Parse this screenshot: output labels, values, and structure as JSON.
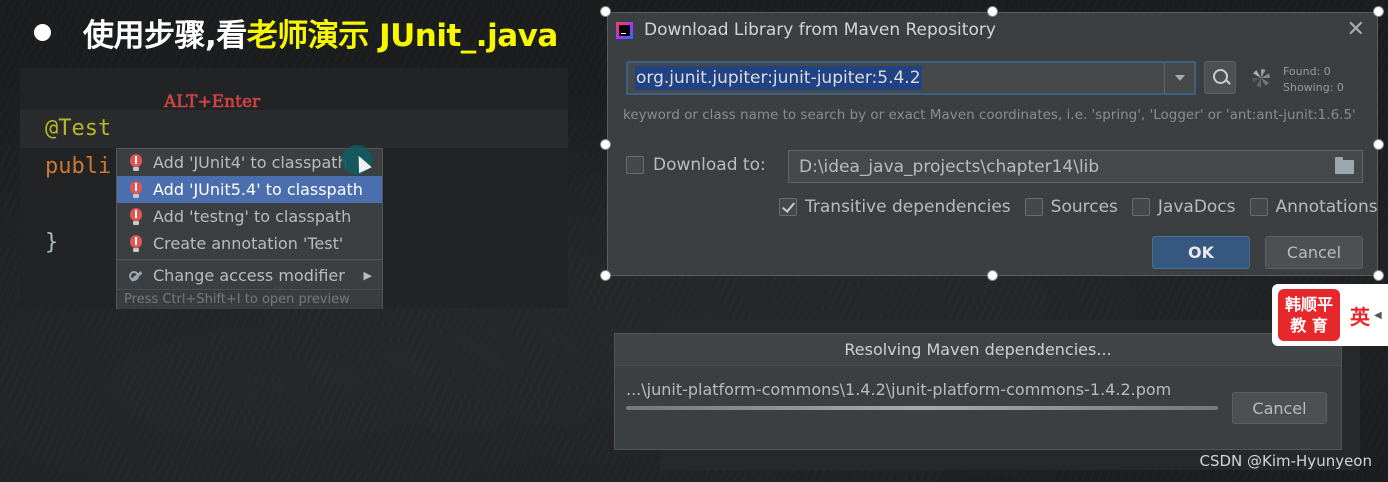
{
  "slide": {
    "title_prefix": "使用步骤,看",
    "title_highlight": "老师演示 JUnit_.java"
  },
  "editor": {
    "hint": "ALT+Enter",
    "line1": "@Test",
    "line2": "publi",
    "line3": "}"
  },
  "popup": {
    "items": [
      {
        "label": "Add 'JUnit4' to classpath"
      },
      {
        "label": "Add 'JUnit5.4' to classpath"
      },
      {
        "label": "Add 'testng' to classpath"
      },
      {
        "label": "Create annotation 'Test'"
      }
    ],
    "change_access": "Change access modifier",
    "arrow": "▶",
    "footer": "Press Ctrl+Shift+I to open preview"
  },
  "dialog": {
    "title": "Download Library from Maven Repository",
    "close": "✕",
    "search_value": "org.junit.jupiter:junit-jupiter:5.4.2",
    "found": "Found: 0",
    "showing": "Showing: 0",
    "hint": "keyword or class name to search by or exact Maven coordinates, i.e. 'spring', 'Logger' or 'ant:ant-junit:1.6.5'",
    "download_to_label": "Download to:",
    "download_path": "D:\\idea_java_projects\\chapter14\\lib",
    "options": [
      {
        "label": "Transitive dependencies",
        "checked": true
      },
      {
        "label": "Sources",
        "checked": false
      },
      {
        "label": "JavaDocs",
        "checked": false
      },
      {
        "label": "Annotations",
        "checked": false
      }
    ],
    "ok": "OK",
    "cancel": "Cancel"
  },
  "progress": {
    "title": "Resolving Maven dependencies...",
    "file": "...\\junit-platform-commons\\1.4.2\\junit-platform-commons-1.4.2.pom",
    "fraction": 1.0,
    "cancel": "Cancel"
  },
  "badge": {
    "logo_line1": "韩顺平",
    "logo_line2": "教 育",
    "lang": "英"
  },
  "watermark": "CSDN @Kim-Hyunyeon",
  "colors": {
    "title_highlight": "#f7f700",
    "annotation": "#bbb529",
    "keyword": "#cc7832",
    "selection": "#4b6eaf",
    "ok_button": "#365880",
    "brand_red": "#e6282d"
  }
}
